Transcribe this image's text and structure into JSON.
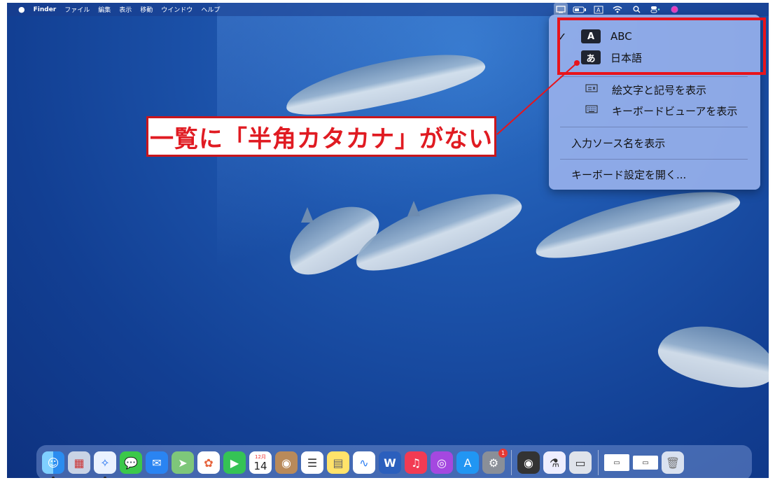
{
  "menubar": {
    "apple_icon": "apple-icon",
    "app_name": "Finder",
    "items": [
      "ファイル",
      "編集",
      "表示",
      "移動",
      "ウインドウ",
      "ヘルプ"
    ],
    "status_icons": [
      "input-source-icon",
      "battery-icon",
      "keyboard-a-icon",
      "wifi-icon",
      "search-icon",
      "control-center-icon",
      "siri-icon"
    ]
  },
  "input_menu": {
    "sources": [
      {
        "badge": "A",
        "label": "ABC",
        "checked": true
      },
      {
        "badge": "あ",
        "label": "日本語",
        "checked": false
      }
    ],
    "check_mark": "✓",
    "actions": [
      {
        "label": "絵文字と記号を表示",
        "icon": "emoji-viewer-icon"
      },
      {
        "label": "キーボードビューアを表示",
        "icon": "keyboard-viewer-icon"
      }
    ],
    "show_names": "入力ソース名を表示",
    "open_settings": "キーボード設定を開く..."
  },
  "annotation": {
    "callout_text": "一覧に「半角カタカナ」がない",
    "highlight_color": "#e8141b"
  },
  "dock": {
    "calendar_month": "12月",
    "calendar_day": "14",
    "settings_badge": "1",
    "apps": [
      "finder",
      "launchpad",
      "safari",
      "messages",
      "mail",
      "maps",
      "photos",
      "facetime",
      "calendar",
      "contacts",
      "reminders",
      "notes",
      "freeform",
      "word",
      "music",
      "podcasts",
      "app-store",
      "system-settings"
    ],
    "utilities": [
      "quicktime",
      "preview-scanner",
      "screenshot",
      "window-a",
      "window-b",
      "trash"
    ]
  }
}
